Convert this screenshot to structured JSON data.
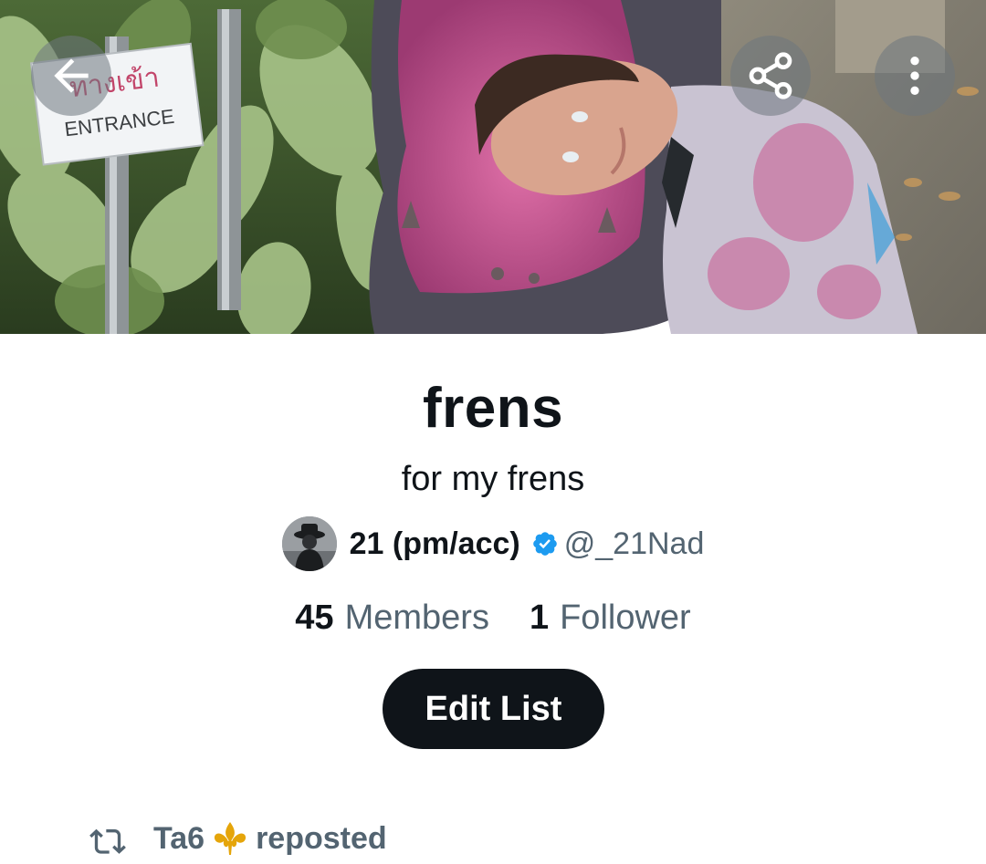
{
  "banner": {
    "sign_thai": "ทางเข้า",
    "sign_english": "ENTRANCE"
  },
  "header": {
    "back_icon": "arrow-left-icon",
    "share_icon": "share-icon",
    "more_icon": "more-vertical-icon"
  },
  "list": {
    "title": "frens",
    "description": "for my frens"
  },
  "owner": {
    "name": "21 (pm/acc)",
    "handle": "@_21Nad",
    "verified": true
  },
  "stats": {
    "members_count": "45",
    "members_label": "Members",
    "followers_count": "1",
    "followers_label": "Follower"
  },
  "actions": {
    "edit_label": "Edit List"
  },
  "repost": {
    "user": "Ta6",
    "emoji": "⚜",
    "label": "reposted"
  },
  "colors": {
    "text_primary": "#0f1419",
    "text_secondary": "#536471",
    "verified_blue": "#1d9bf0",
    "button_dark": "#0f1419",
    "emoji_gold": "#e5a50a"
  }
}
